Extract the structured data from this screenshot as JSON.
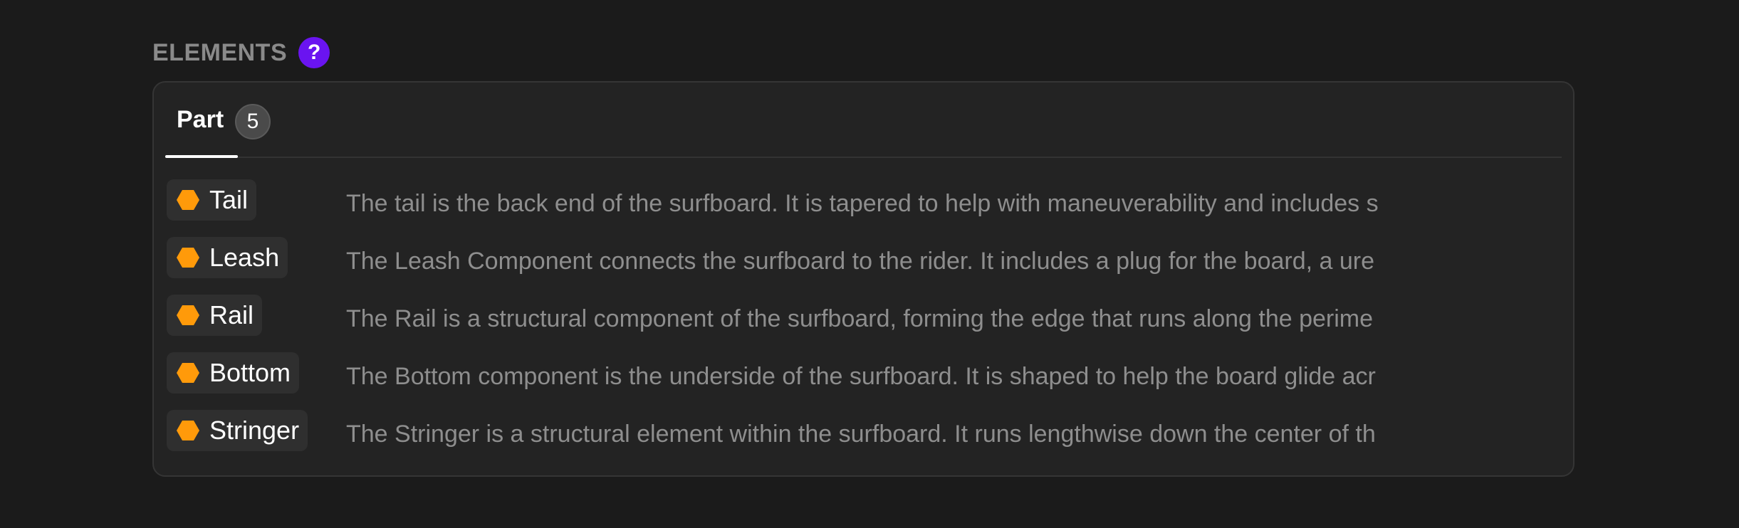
{
  "section": {
    "title": "ELEMENTS",
    "help_icon": "?"
  },
  "tabs": [
    {
      "label": "Part",
      "count": "5",
      "active": true
    }
  ],
  "parts": [
    {
      "name": "Tail",
      "icon": "hexagon-icon",
      "description": "The tail is the back end of the surfboard. It is tapered to help with maneuverability and includes s"
    },
    {
      "name": "Leash",
      "icon": "hexagon-icon",
      "description": "The Leash Component connects the surfboard to the rider. It includes a plug for the board, a ure"
    },
    {
      "name": "Rail",
      "icon": "hexagon-icon",
      "description": "The Rail is a structural component of the surfboard, forming the edge that runs along the perime"
    },
    {
      "name": "Bottom",
      "icon": "hexagon-icon",
      "description": "The Bottom component is the underside of the surfboard. It is shaped to help the board glide acr"
    },
    {
      "name": "Stringer",
      "icon": "hexagon-icon",
      "description": "The Stringer is a structural element within the surfboard. It runs lengthwise down the center of th"
    }
  ],
  "colors": {
    "background": "#1b1b1b",
    "panel": "#232323",
    "accent_help": "#6a14f0",
    "part_icon": "#ff9a0a"
  }
}
